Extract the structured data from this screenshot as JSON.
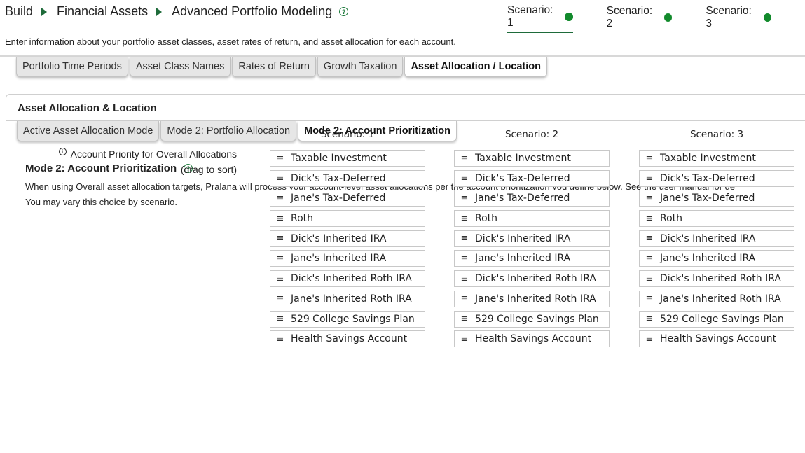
{
  "breadcrumb": [
    "Build",
    "Financial Assets",
    "Advanced Portfolio Modeling"
  ],
  "help_glyph": "?",
  "scenarios": [
    "Scenario: 1",
    "Scenario: 2",
    "Scenario: 3"
  ],
  "scenario_status_color": "#128a2c",
  "intro": "Enter information about your portfolio asset classes, asset rates of return, and asset allocation for each account.",
  "main_tabs": [
    "Portfolio Time Periods",
    "Asset Class Names",
    "Rates of Return",
    "Growth Taxation",
    "Asset Allocation / Location"
  ],
  "active_main_tab": "Asset Allocation / Location",
  "panel_title": "Asset Allocation & Location",
  "sub_tabs": [
    "Active Asset Allocation Mode",
    "Mode 2: Portfolio Allocation",
    "Mode 2: Account Prioritization"
  ],
  "active_sub_tab": "Mode 2: Account Prioritization",
  "section": {
    "title": "Mode 2: Account Prioritization",
    "desc_line1": "When using Overall asset allocation targets, Pralana will process your account-level asset allocations per the account prioritization you define below. See the user manual for de",
    "desc_line2": "You may vary this choice by scenario."
  },
  "field": {
    "info_glyph": "i",
    "label_line1": "Account Priority for Overall Allocations",
    "label_line2": "(drag to sort)"
  },
  "drag_handle_icon": "≡",
  "columns": [
    {
      "header": "Scenario: 1",
      "items": [
        "Taxable Investment",
        "Dick's Tax-Deferred",
        "Jane's Tax-Deferred",
        "Roth",
        "Dick's Inherited IRA",
        "Jane's Inherited IRA",
        "Dick's Inherited Roth IRA",
        "Jane's Inherited Roth IRA",
        "529 College Savings Plan",
        "Health Savings Account"
      ]
    },
    {
      "header": "Scenario: 2",
      "items": [
        "Taxable Investment",
        "Dick's Tax-Deferred",
        "Jane's Tax-Deferred",
        "Roth",
        "Dick's Inherited IRA",
        "Jane's Inherited IRA",
        "Dick's Inherited Roth IRA",
        "Jane's Inherited Roth IRA",
        "529 College Savings Plan",
        "Health Savings Account"
      ]
    },
    {
      "header": "Scenario: 3",
      "items": [
        "Taxable Investment",
        "Dick's Tax-Deferred",
        "Jane's Tax-Deferred",
        "Roth",
        "Dick's Inherited IRA",
        "Jane's Inherited IRA",
        "Dick's Inherited Roth IRA",
        "Jane's Inherited Roth IRA",
        "529 College Savings Plan",
        "Health Savings Account"
      ]
    }
  ]
}
